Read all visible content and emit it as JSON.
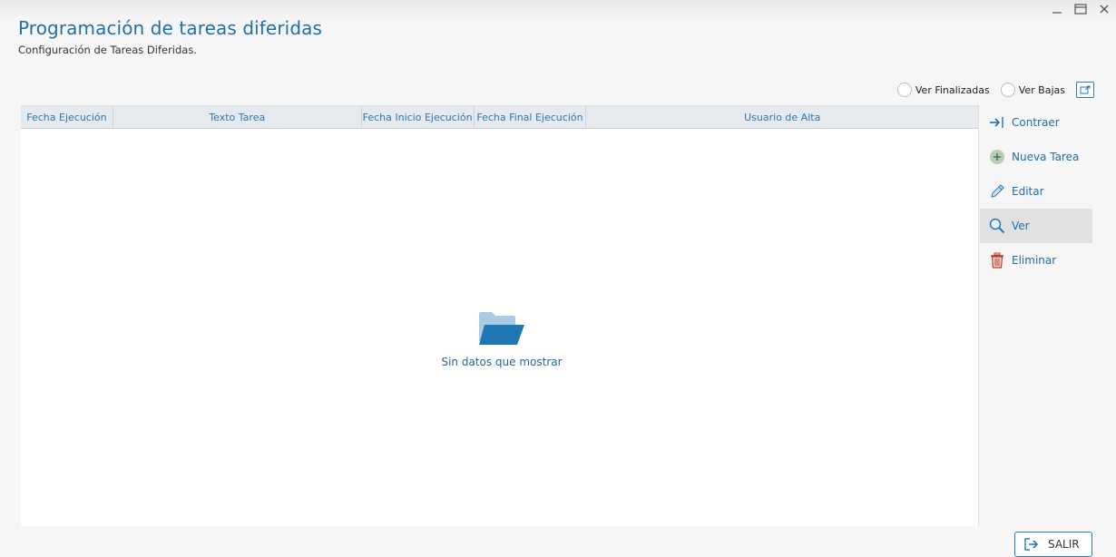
{
  "window": {
    "minimize_icon": "minimize-icon",
    "maximize_icon": "maximize-icon",
    "close_icon": "close-icon"
  },
  "header": {
    "title": "Programación de tareas diferidas",
    "subtitle": "Configuración de Tareas Diferidas."
  },
  "filters": {
    "ver_finalizadas": "Ver Finalizadas",
    "ver_bajas": "Ver Bajas",
    "export_icon": "export-icon"
  },
  "grid": {
    "columns": [
      "Fecha Ejecución",
      "Texto Tarea",
      "Fecha Inicio Ejecución",
      "Fecha Final Ejecución",
      "Usuario de Alta"
    ],
    "rows": [],
    "empty_message": "Sin datos que mostrar"
  },
  "actions": {
    "contraer": "Contraer",
    "nueva_tarea": "Nueva Tarea",
    "editar": "Editar",
    "ver": "Ver",
    "eliminar": "Eliminar"
  },
  "footer": {
    "salir": "SALIR"
  },
  "colors": {
    "accent": "#1f6fa8",
    "header_bg": "#e6e9ed",
    "active_action_bg": "#e1e1e1",
    "delete_icon": "#c0392b",
    "add_icon": "#7fae7b"
  }
}
